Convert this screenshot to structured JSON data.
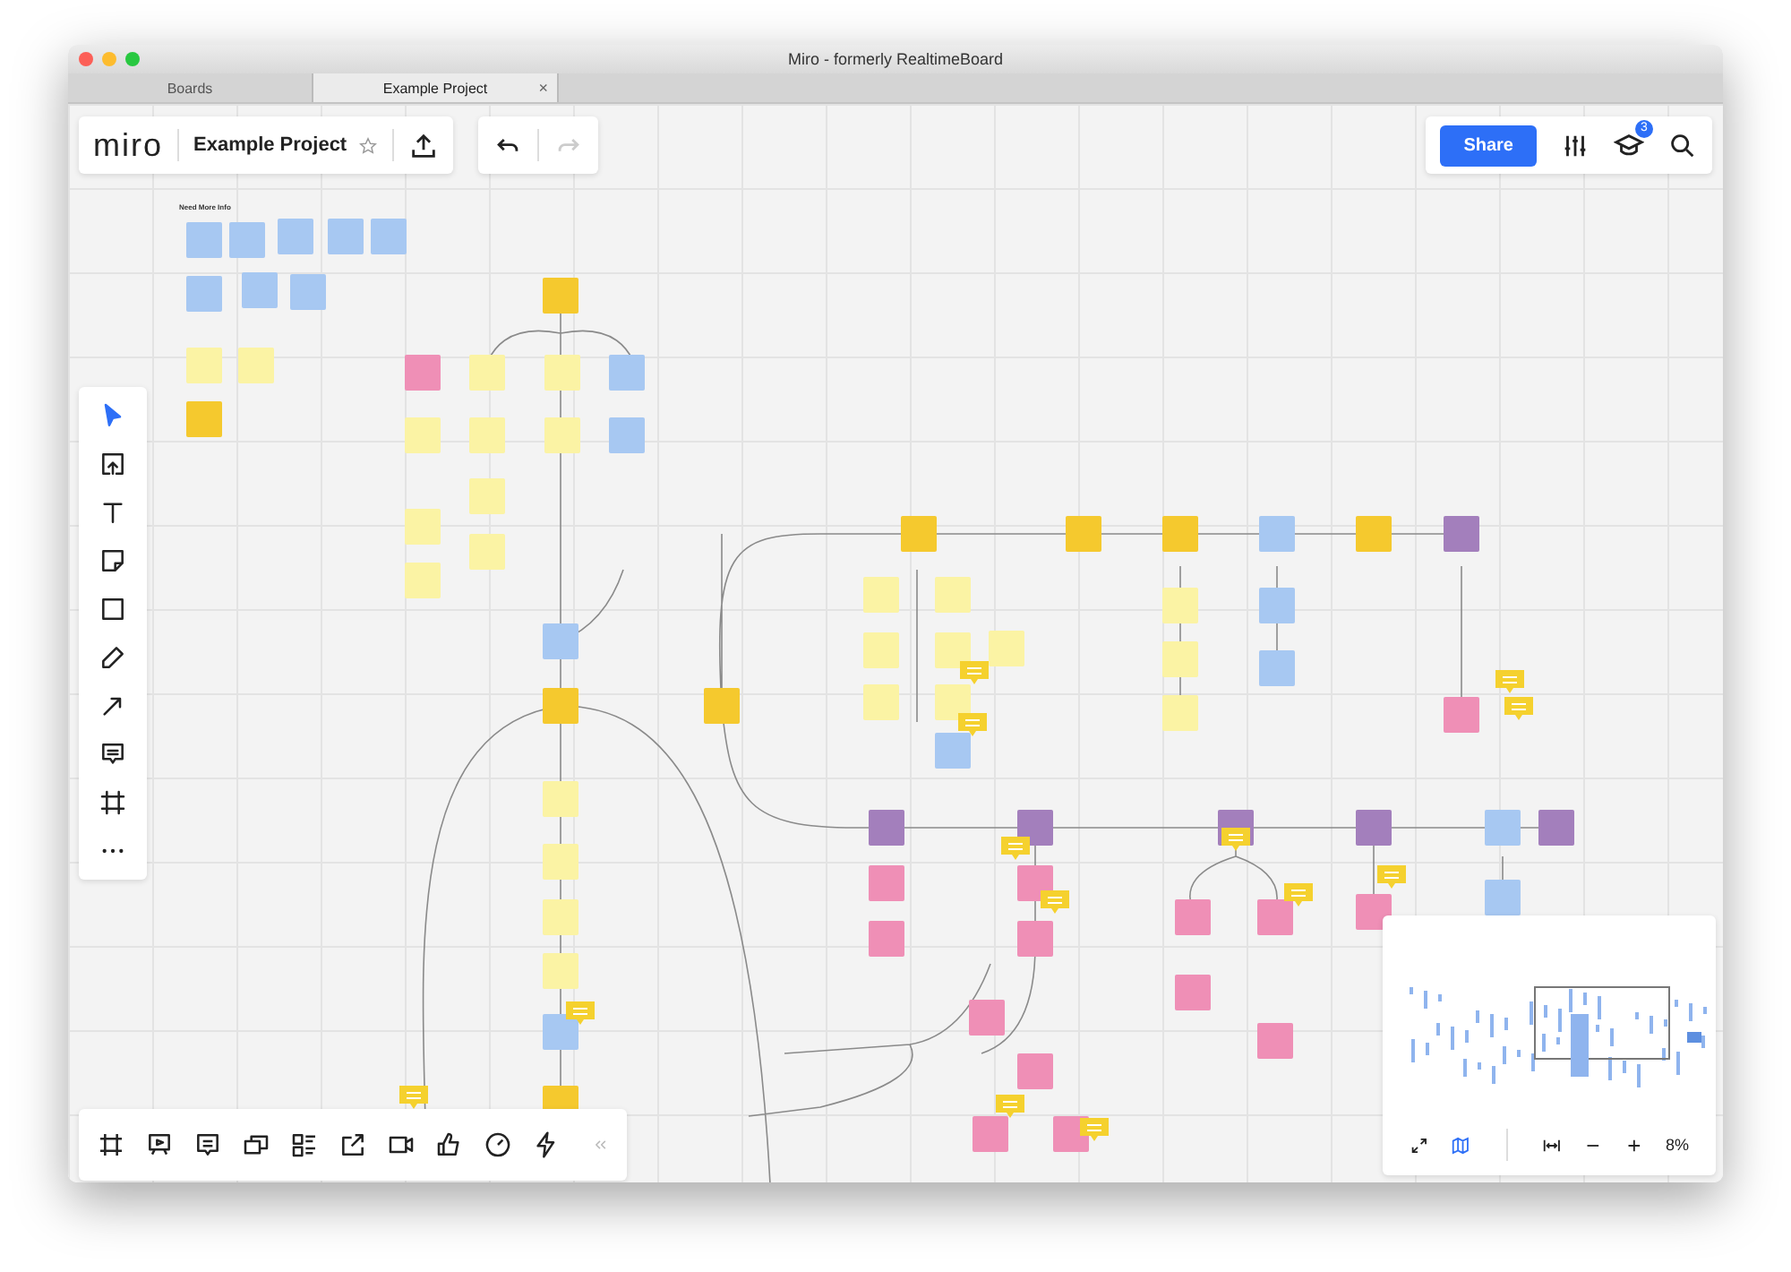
{
  "window": {
    "title": "Miro - formerly RealtimeBoard"
  },
  "tabs": [
    {
      "label": "Boards",
      "selected": false
    },
    {
      "label": "Example Project",
      "selected": true,
      "close": "×"
    }
  ],
  "header": {
    "logo": "miro",
    "board_name": "Example Project",
    "starred": false
  },
  "history": {
    "undo_disabled": false,
    "redo_disabled": true
  },
  "share_button": "Share",
  "notification_badge": "3",
  "tools": [
    {
      "kind": "select",
      "selected": true
    },
    {
      "kind": "upload",
      "selected": false
    },
    {
      "kind": "text",
      "selected": false
    },
    {
      "kind": "sticky",
      "selected": false
    },
    {
      "kind": "shape",
      "selected": false
    },
    {
      "kind": "pen",
      "selected": false
    },
    {
      "kind": "arrow",
      "selected": false
    },
    {
      "kind": "comment",
      "selected": false
    },
    {
      "kind": "frame",
      "selected": false
    },
    {
      "kind": "more",
      "selected": false
    }
  ],
  "bottom_tools": [
    {
      "kind": "frames"
    },
    {
      "kind": "presentation"
    },
    {
      "kind": "comments"
    },
    {
      "kind": "screens"
    },
    {
      "kind": "cards"
    },
    {
      "kind": "export"
    },
    {
      "kind": "video"
    },
    {
      "kind": "vote"
    },
    {
      "kind": "timer"
    },
    {
      "kind": "lightning"
    },
    {
      "kind": "collapse"
    }
  ],
  "board": {
    "section_label": "Need More Info"
  },
  "navigator": {
    "map_shown": true,
    "zoom_reading": "8%"
  }
}
